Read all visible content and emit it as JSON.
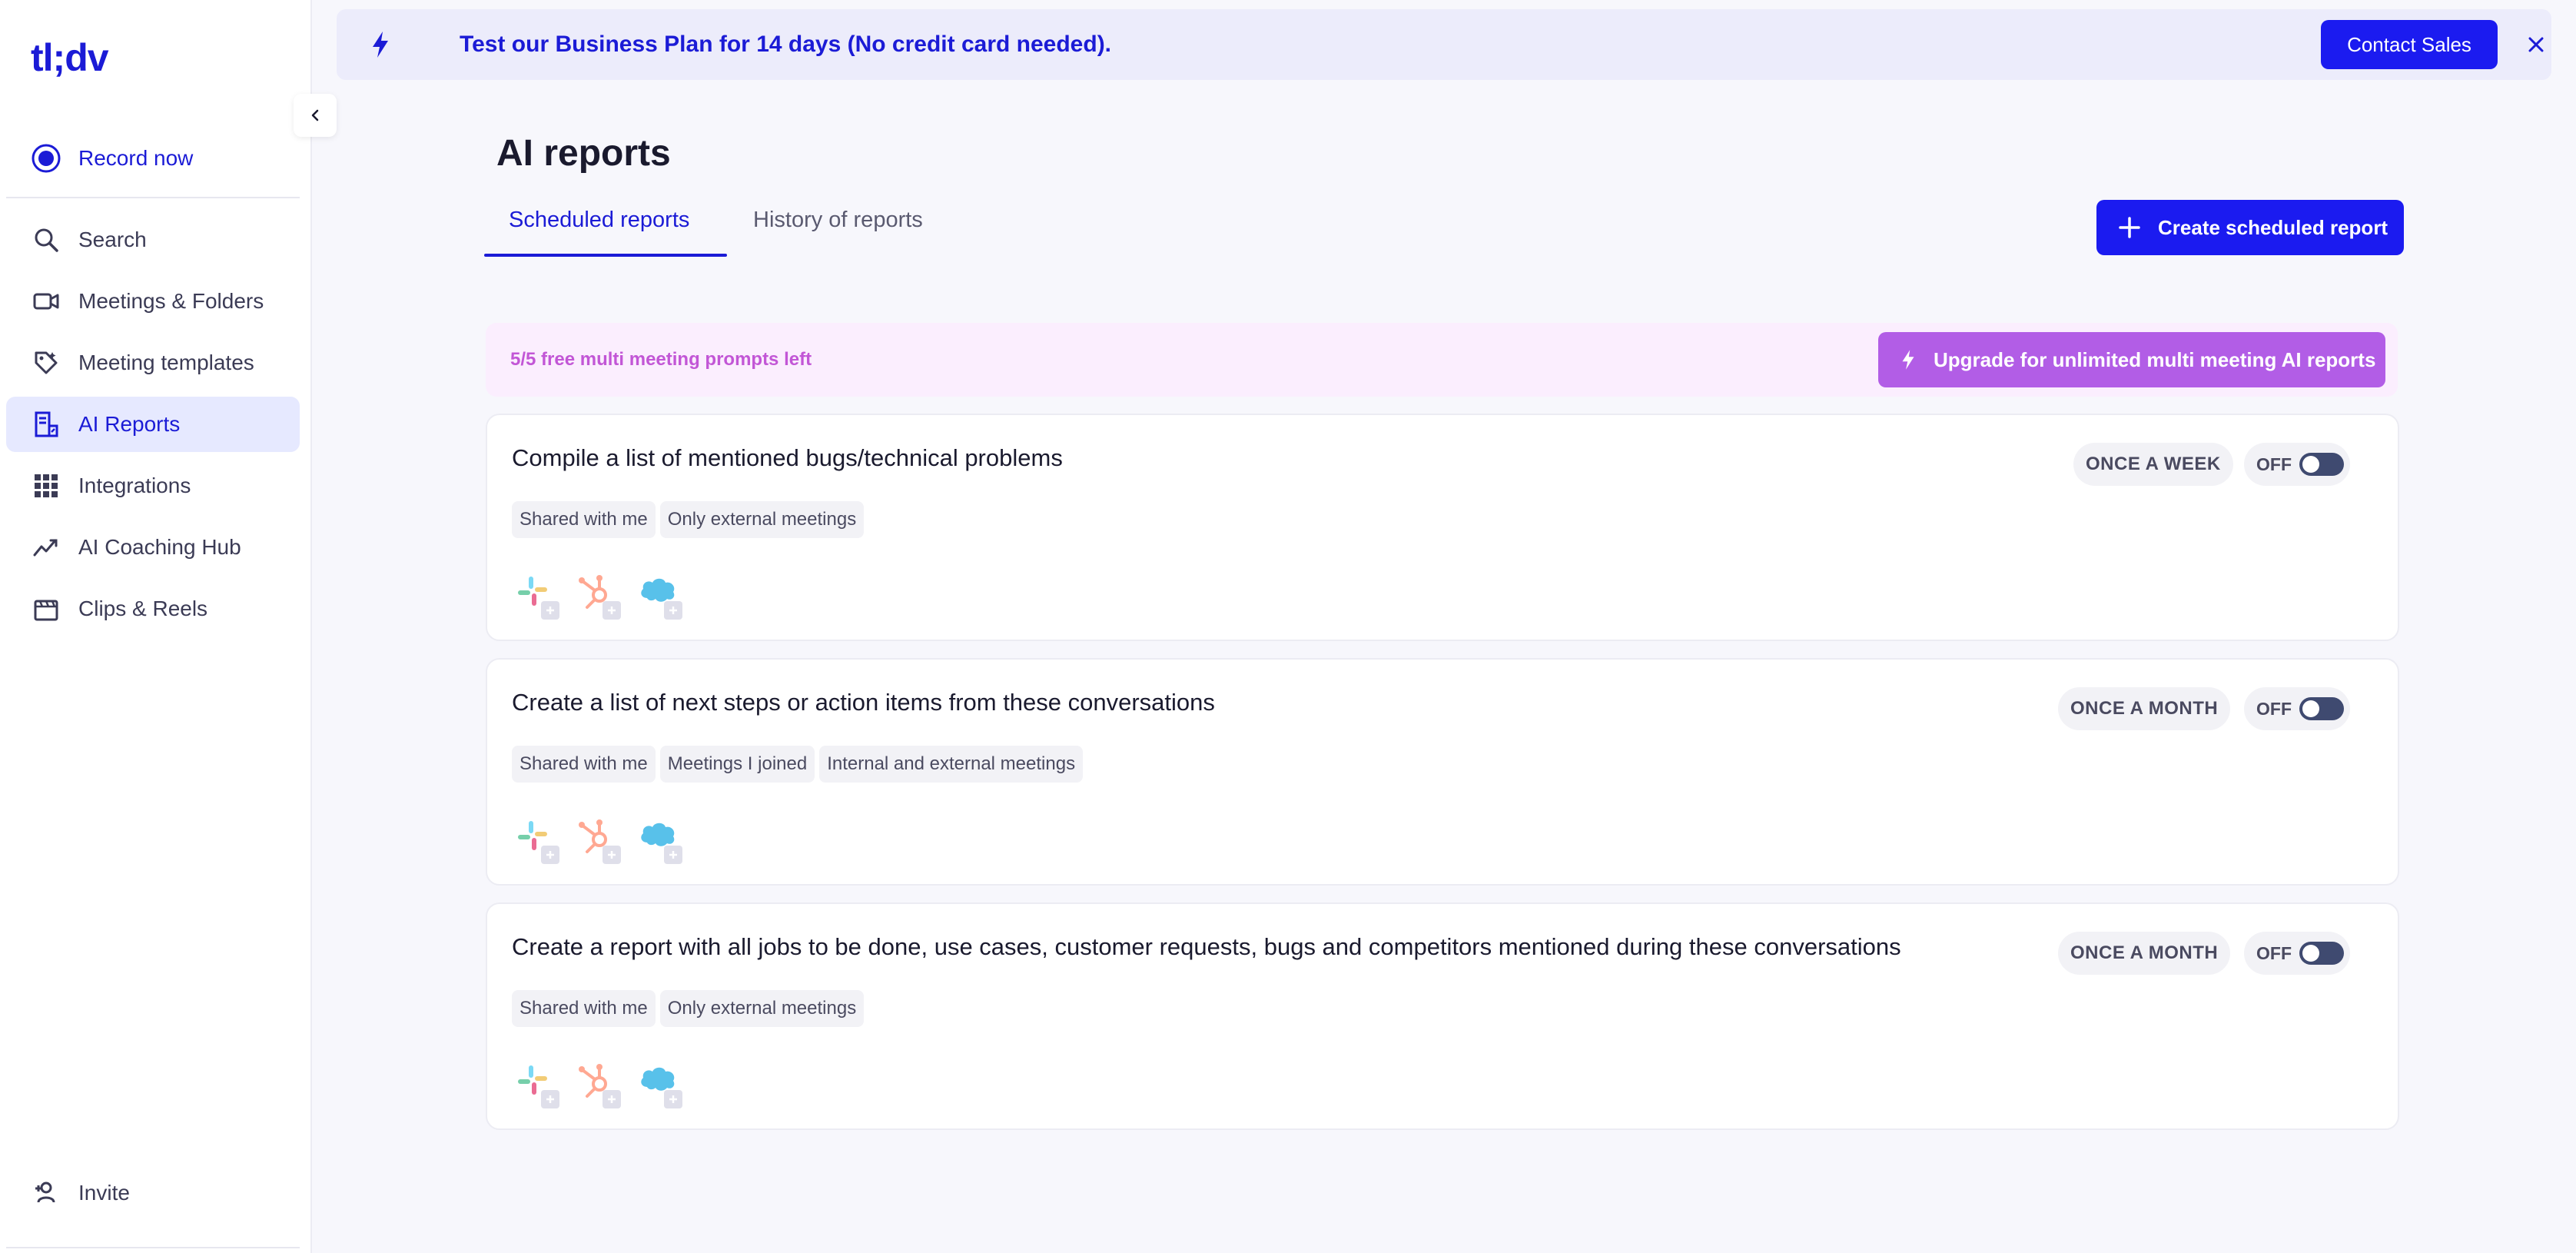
{
  "sidebar": {
    "logo": "tl;dv",
    "record_now": "Record now",
    "items": [
      {
        "label": "Search"
      },
      {
        "label": "Meetings & Folders"
      },
      {
        "label": "Meeting templates"
      },
      {
        "label": "AI Reports"
      },
      {
        "label": "Integrations"
      },
      {
        "label": "AI Coaching Hub"
      },
      {
        "label": "Clips & Reels"
      }
    ],
    "invite": "Invite"
  },
  "banner": {
    "text": "Test our Business Plan for 14 days (No credit card needed).",
    "contact_label": "Contact Sales"
  },
  "page": {
    "title": "AI reports",
    "tabs": [
      {
        "label": "Scheduled reports"
      },
      {
        "label": "History of reports"
      }
    ],
    "create_label": "Create scheduled report"
  },
  "quota": {
    "text": "5/5 free multi meeting prompts left",
    "upgrade_label": "Upgrade for unlimited multi meeting AI reports"
  },
  "reports": [
    {
      "title": "Compile a list of mentioned bugs/technical problems",
      "tags": [
        "Shared with me",
        "Only external meetings"
      ],
      "frequency": "ONCE A WEEK",
      "status": "OFF"
    },
    {
      "title": "Create a list of next steps or action items from these conversations",
      "tags": [
        "Shared with me",
        "Meetings I joined",
        "Internal and external meetings"
      ],
      "frequency": "ONCE A MONTH",
      "status": "OFF"
    },
    {
      "title": "Create a report with all jobs to be done, use cases, customer requests, bugs and competitors mentioned during these conversations",
      "tags": [
        "Shared with me",
        "Only external meetings"
      ],
      "frequency": "ONCE A MONTH",
      "status": "OFF"
    }
  ],
  "colors": {
    "brand": "#1b1bd6",
    "primary_button": "#1b1bf0",
    "upgrade": "#b25de6",
    "quota_text": "#c256d6"
  },
  "icons": [
    "bolt-icon",
    "close-icon",
    "plus-icon",
    "record-icon",
    "search-icon",
    "video-icon",
    "template-icon",
    "report-icon",
    "grid-icon",
    "chart-icon",
    "clip-icon",
    "invite-icon",
    "slack-icon",
    "hubspot-icon",
    "salesforce-icon"
  ]
}
